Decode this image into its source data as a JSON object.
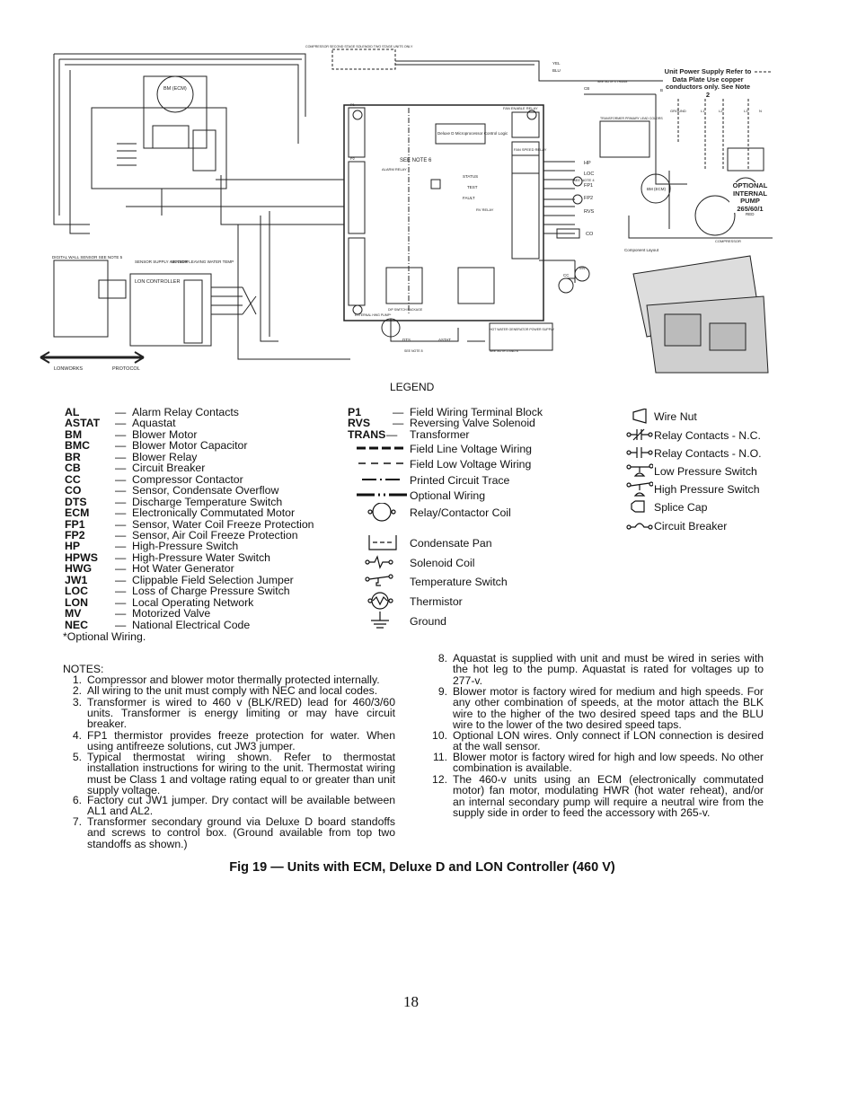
{
  "diagram": {
    "labels": [
      "BM (ECM)",
      "LON CONTROLLER",
      "DIGITAL WALL SENSOR SEE NOTE 5",
      "SENSOR SUPPLY AIR TEMP",
      "SENSOR LEAVING WATER TEMP",
      "LONWORKS",
      "PROTOCOL",
      "COMPRESSOR SECOND STAGE SOLENOID TWO STAGE UNITS ONLY",
      "Deluxe D Microprocessor Control Logic",
      "SEE NOTE 6",
      "FAN ENABLE RELAY",
      "FAN SPEED RELAY",
      "ALARM RELAY",
      "STATUS",
      "TEST",
      "FAULT",
      "RV RELAY",
      "HP",
      "LOC",
      "FP1",
      "FP2",
      "RVS",
      "CO",
      "SEE NOTE 4",
      "CC",
      "MV",
      "Unit Power Supply Refer to Data Plate Use copper conductors only. See Note 2",
      "TRANSFORMER PRIMARY LEAD COLORS",
      "SEE NOTE 3 TRANS",
      "CB",
      "BLK",
      "YEL",
      "BLU",
      "RED",
      "BM (ECM)",
      "COMPRESSOR",
      "OPTIONAL INTERNAL PUMP 265/60/1",
      "PUMP",
      "GROUND",
      "L1",
      "L2",
      "L3",
      "N",
      "Component Layout",
      "EXTERNAL HWG PUMP*",
      "DTS",
      "ASTAT",
      "HOT WATER GENERATOR POWER SUPPLY",
      "SEE NOTE 2 AND 8",
      "SEE NOTE 8",
      "DIP SWITCH PACKAGE",
      "P1",
      "P2"
    ]
  },
  "legend": {
    "title": "LEGEND",
    "abbreviations_left": [
      {
        "abbr": "AL",
        "desc": "Alarm Relay Contacts"
      },
      {
        "abbr": "ASTAT",
        "desc": "Aquastat"
      },
      {
        "abbr": "BM",
        "desc": "Blower Motor"
      },
      {
        "abbr": "BMC",
        "desc": "Blower Motor Capacitor"
      },
      {
        "abbr": "BR",
        "desc": "Blower Relay"
      },
      {
        "abbr": "CB",
        "desc": "Circuit Breaker"
      },
      {
        "abbr": "CC",
        "desc": "Compressor Contactor"
      },
      {
        "abbr": "CO",
        "desc": "Sensor, Condensate Overflow"
      },
      {
        "abbr": "DTS",
        "desc": "Discharge Temperature Switch"
      },
      {
        "abbr": "ECM",
        "desc": "Electronically Commutated Motor"
      },
      {
        "abbr": "FP1",
        "desc": "Sensor, Water Coil Freeze Protection"
      },
      {
        "abbr": "FP2",
        "desc": "Sensor, Air Coil Freeze Protection"
      },
      {
        "abbr": "HP",
        "desc": "High-Pressure Switch"
      },
      {
        "abbr": "HPWS",
        "desc": "High-Pressure Water Switch"
      },
      {
        "abbr": "HWG",
        "desc": "Hot Water Generator"
      },
      {
        "abbr": "JW1",
        "desc": "Clippable Field Selection Jumper"
      },
      {
        "abbr": "LOC",
        "desc": "Loss of Charge Pressure Switch"
      },
      {
        "abbr": "LON",
        "desc": "Local Operating Network"
      },
      {
        "abbr": "MV",
        "desc": "Motorized Valve"
      },
      {
        "abbr": "NEC",
        "desc": "National Electrical Code"
      }
    ],
    "optional_note": "*Optional Wiring.",
    "abbreviations_mid": [
      {
        "abbr": "P1",
        "desc": "Field Wiring Terminal Block"
      },
      {
        "abbr": "RVS",
        "desc": "Reversing Valve Solenoid"
      },
      {
        "abbr": "TRANS",
        "desc": "Transformer"
      }
    ],
    "dash": "—",
    "symbols_mid": [
      {
        "icon": "field-line-voltage-wiring-icon",
        "label": "Field Line Voltage Wiring"
      },
      {
        "icon": "field-low-voltage-wiring-icon",
        "label": "Field Low Voltage Wiring"
      },
      {
        "icon": "printed-circuit-trace-icon",
        "label": "Printed Circuit Trace"
      },
      {
        "icon": "optional-wiring-icon",
        "label": "Optional Wiring"
      },
      {
        "icon": "relay-coil-icon",
        "label": "Relay/Contactor Coil"
      },
      {
        "icon": "condensate-pan-icon",
        "label": "Condensate Pan"
      },
      {
        "icon": "solenoid-coil-icon",
        "label": "Solenoid Coil"
      },
      {
        "icon": "temperature-switch-icon",
        "label": "Temperature Switch"
      },
      {
        "icon": "thermistor-icon",
        "label": "Thermistor"
      },
      {
        "icon": "ground-icon",
        "label": "Ground"
      }
    ],
    "symbols_right": [
      {
        "icon": "wire-nut-icon",
        "label": "Wire Nut"
      },
      {
        "icon": "relay-contacts-nc-icon",
        "label": "Relay Contacts - N.C."
      },
      {
        "icon": "relay-contacts-no-icon",
        "label": "Relay Contacts - N.O."
      },
      {
        "icon": "low-pressure-switch-icon",
        "label": "Low Pressure Switch"
      },
      {
        "icon": "high-pressure-switch-icon",
        "label": "High Pressure Switch"
      },
      {
        "icon": "splice-cap-icon",
        "label": "Splice Cap"
      },
      {
        "icon": "circuit-breaker-icon",
        "label": "Circuit Breaker"
      }
    ]
  },
  "notes": {
    "title": "NOTES:",
    "items": [
      {
        "num": "1.",
        "text": "Compressor and blower motor thermally protected internally."
      },
      {
        "num": "2.",
        "text": "All wiring to the unit must comply with NEC and local codes."
      },
      {
        "num": "3.",
        "text": "Transformer is wired to 460 v (BLK/RED) lead for 460/3/60 units. Transformer is energy limiting or may have circuit breaker."
      },
      {
        "num": "4.",
        "text": "FP1 thermistor provides freeze protection for water. When using antifreeze solutions, cut JW3 jumper."
      },
      {
        "num": "5.",
        "text": "Typical thermostat wiring shown. Refer to thermostat installation instructions for wiring to the unit. Thermostat wiring must be Class 1 and voltage rating equal to or greater than unit supply voltage."
      },
      {
        "num": "6.",
        "text": "Factory cut JW1 jumper. Dry contact will be available between AL1 and AL2."
      },
      {
        "num": "7.",
        "text": "Transformer secondary ground via Deluxe D board standoffs and screws to control box. (Ground available from top two standoffs as shown.)"
      },
      {
        "num": "8.",
        "text": "Aquastat is supplied with unit and must be wired in series with the hot leg to the pump. Aquastat is rated for voltages up to 277-v."
      },
      {
        "num": "9.",
        "text": "Blower motor is factory wired for medium and high speeds. For any other combination of speeds, at the motor attach the BLK wire to the higher of the two desired speed taps and the BLU wire to the lower of the two desired speed taps."
      },
      {
        "num": "10.",
        "text": "Optional LON wires. Only connect if LON connection is desired at the wall sensor."
      },
      {
        "num": "11.",
        "text": "Blower motor is factory wired for high and low speeds. No other combination is available."
      },
      {
        "num": "12.",
        "text": "The 460-v units using an ECM (electronically commutated motor) fan motor, modulating HWR (hot water reheat), and/or an internal secondary pump will require a neutral wire from the supply side in order to feed the accessory with 265-v."
      }
    ]
  },
  "caption": "Fig 19 — Units with ECM, Deluxe D and LON Controller (460 V)",
  "page_number": "18"
}
